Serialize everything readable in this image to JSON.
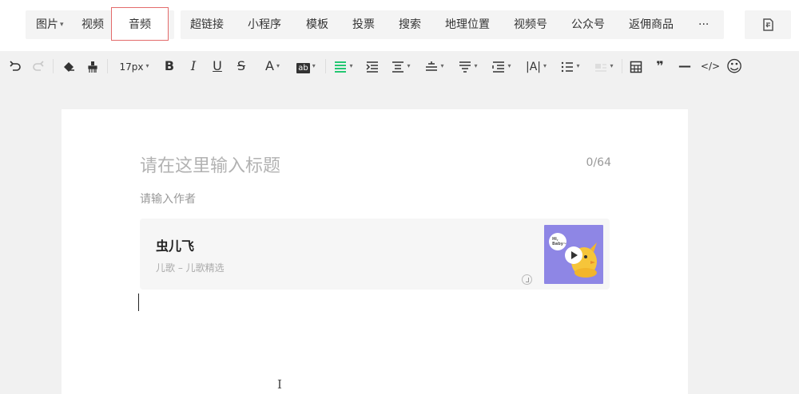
{
  "insert_bar": {
    "group1": [
      {
        "label": "图片",
        "dropdown": true
      },
      {
        "label": "视频",
        "dropdown": false
      },
      {
        "label": "音频",
        "dropdown": false,
        "selected": true
      }
    ],
    "group2": [
      {
        "label": "超链接"
      },
      {
        "label": "小程序"
      },
      {
        "label": "模板"
      },
      {
        "label": "投票"
      },
      {
        "label": "搜索"
      },
      {
        "label": "地理位置"
      },
      {
        "label": "视频号"
      },
      {
        "label": "公众号"
      },
      {
        "label": "返佣商品"
      },
      {
        "label": "···"
      }
    ],
    "active_color": "#e36b6b"
  },
  "toolbar": {
    "font_size": "17px",
    "bold": "B",
    "italic": "I",
    "underline": "U",
    "strike": "S",
    "font_color": "A",
    "bg_color": "ab",
    "letter_spacing": "|A|",
    "quote": "❞",
    "hr": "—",
    "code": "</>",
    "emoji": "☺",
    "accent_color": "#07c160"
  },
  "editor": {
    "title_placeholder": "请在这里输入标题",
    "title_count": "0/64",
    "author_placeholder": "请输入作者",
    "audio": {
      "title": "虫儿飞",
      "subtitle": "儿歌 – 儿歌精选",
      "cover_text": "Hi, Baby~",
      "cover_bg": "#8e86e5"
    }
  }
}
